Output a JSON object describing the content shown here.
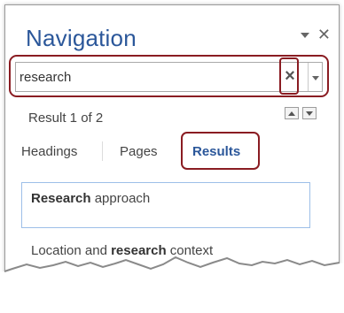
{
  "pane": {
    "title": "Navigation",
    "search": {
      "value": "research",
      "clear_label": "×"
    },
    "result_count": "Result 1 of 2",
    "tabs": [
      {
        "label": "Headings"
      },
      {
        "label": "Pages"
      },
      {
        "label": "Results",
        "active": true
      }
    ],
    "results": [
      {
        "match": "Research",
        "suffix": " approach"
      },
      {
        "prefix": "Location and ",
        "match": "research",
        "suffix": " context"
      }
    ]
  },
  "colors": {
    "title": "#2b579a",
    "highlight_outline": "#8a1c22",
    "selected_result_border": "#9dbfe8"
  }
}
